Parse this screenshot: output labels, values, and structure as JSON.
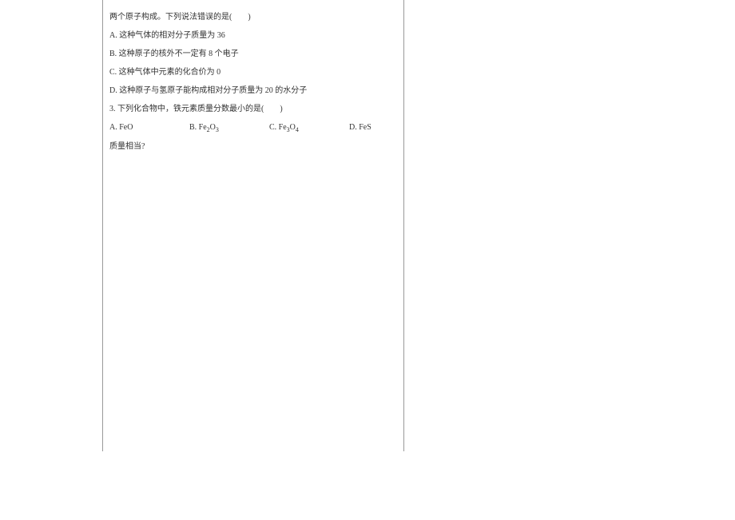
{
  "left": {
    "l1": "两个原子构成。下列说法错误的是(　　)",
    "l2": "A. 这种气体的相对分子质量为 36",
    "l3": "B. 这种原子的核外不一定有 8 个电子",
    "l4": "C. 这种气体中元素的化合价为 0",
    "l5": "D. 这种原子与氢原子能构成相对分子质量为 20 的水分子",
    "l6": "3. 下列化合物中，铁元素质量分数最小的是(　　)",
    "optA_pre": "A. FeO",
    "optB_pre": "B. Fe",
    "optB_sub1": "2",
    "optB_mid": "O",
    "optB_sub2": "3",
    "optC_pre": "C. Fe",
    "optC_sub1": "3",
    "optC_mid": "O",
    "optC_sub2": "4",
    "optD": "D. FeS",
    "l8": "质量相当?"
  }
}
